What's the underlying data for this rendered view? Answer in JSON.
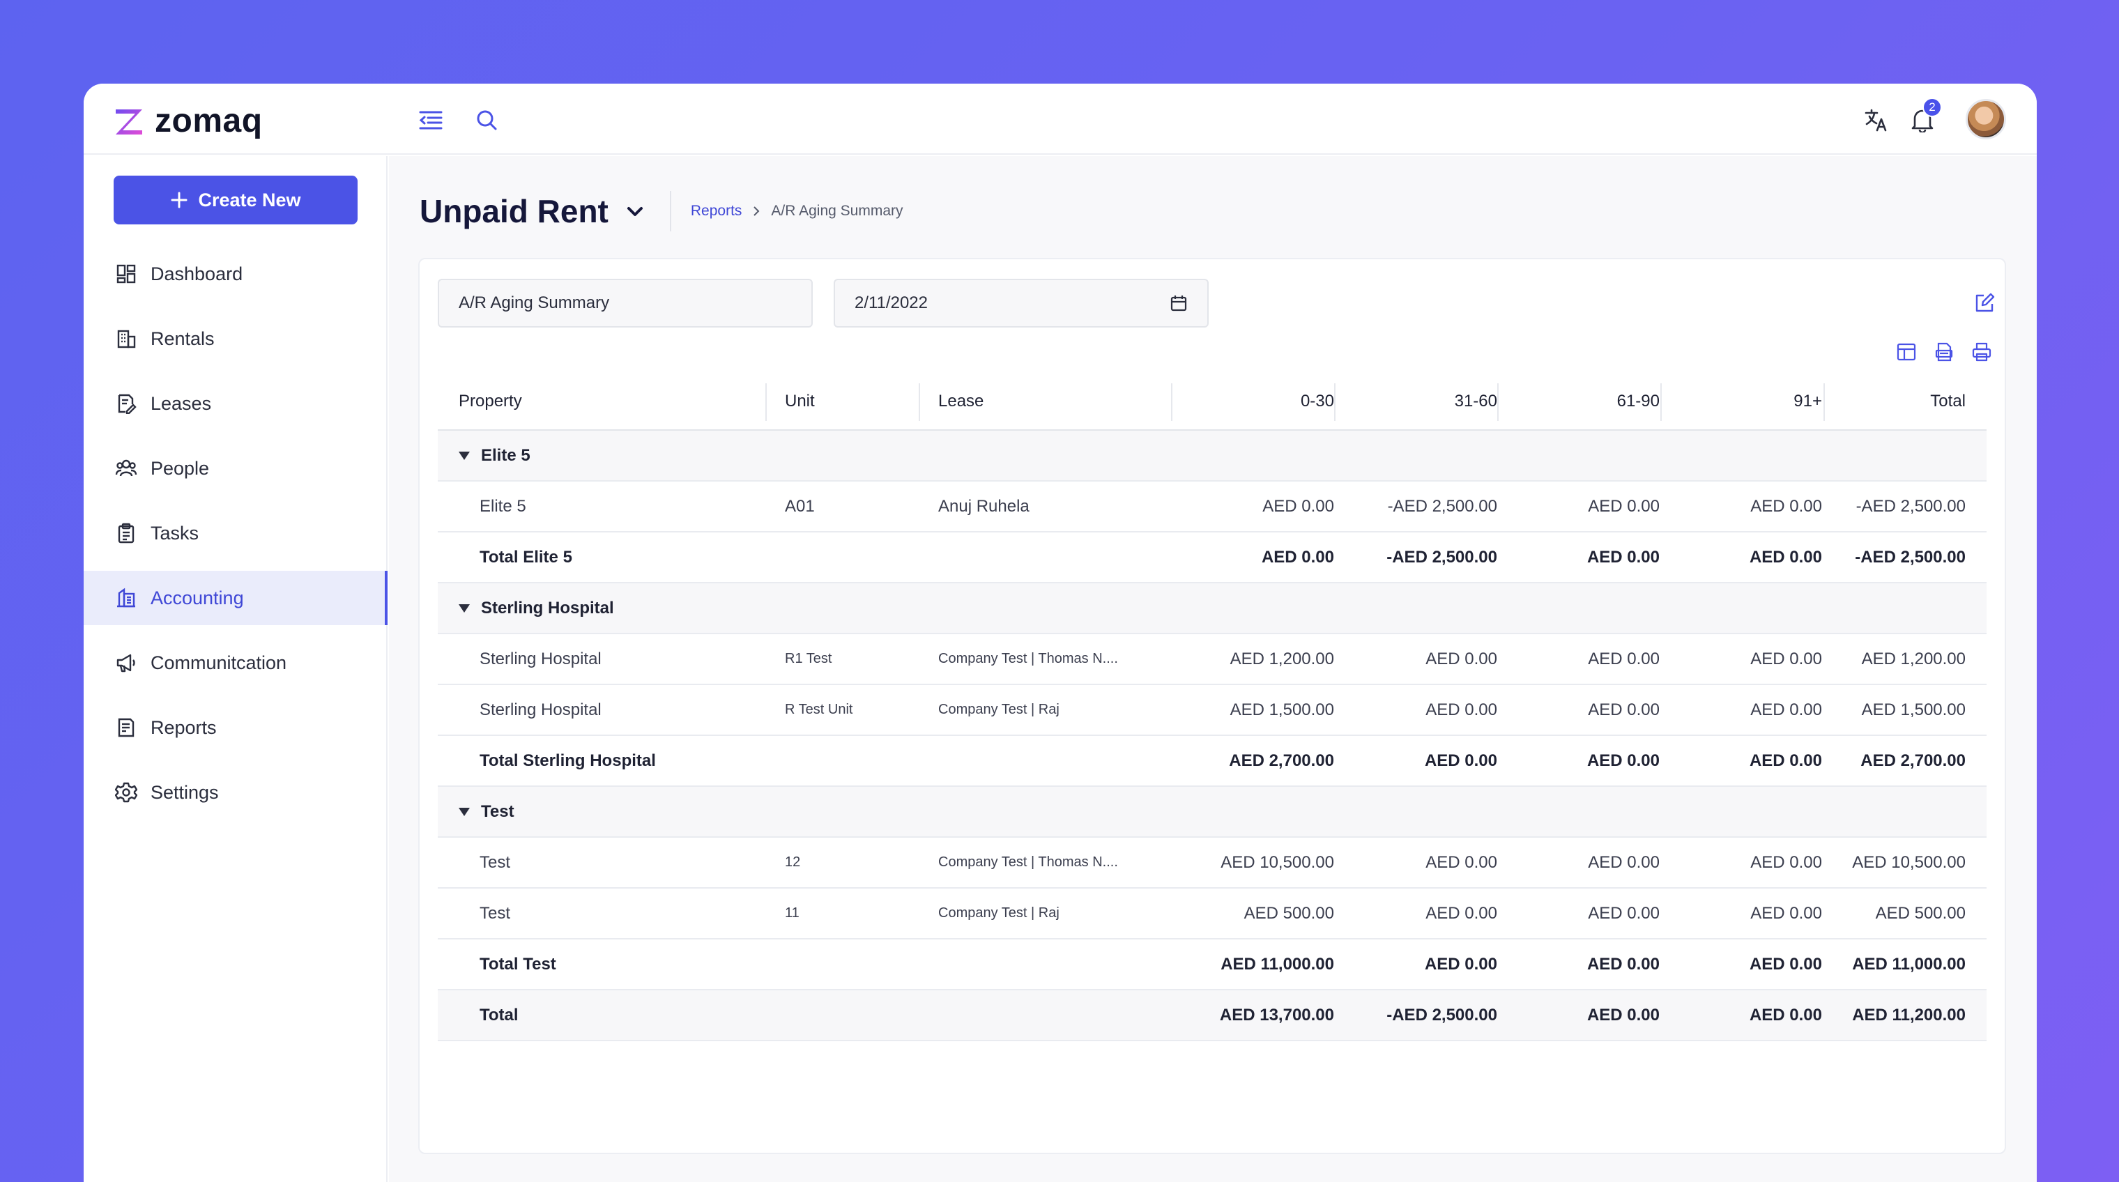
{
  "app": {
    "logo_text": "zomaq",
    "notifications_count": "2"
  },
  "topbar": {
    "icons": [
      "collapse-menu-icon",
      "search-icon",
      "translate-icon",
      "bell-icon"
    ]
  },
  "sidebar": {
    "create_label": "Create New",
    "items": [
      {
        "label": "Dashboard",
        "icon": "dashboard-icon"
      },
      {
        "label": "Rentals",
        "icon": "building-icon"
      },
      {
        "label": "Leases",
        "icon": "lease-icon"
      },
      {
        "label": "People",
        "icon": "people-icon"
      },
      {
        "label": "Tasks",
        "icon": "clipboard-icon"
      },
      {
        "label": "Accounting",
        "icon": "accounting-icon",
        "active": true
      },
      {
        "label": "Communitcation",
        "icon": "megaphone-icon"
      },
      {
        "label": "Reports",
        "icon": "report-icon"
      },
      {
        "label": "Settings",
        "icon": "gear-icon"
      }
    ]
  },
  "header": {
    "title": "Unpaid Rent",
    "breadcrumb": {
      "link": "Reports",
      "current": "A/R Aging Summary"
    }
  },
  "filters": {
    "report_value": "A/R Aging Summary",
    "date_value": "2/11/2022"
  },
  "table": {
    "columns": [
      "Property",
      "Unit",
      "Lease",
      "0-30",
      "31-60",
      "61-90",
      "91+",
      "Total"
    ],
    "groups": [
      {
        "name": "Elite 5",
        "rows": [
          {
            "property": "Elite 5",
            "unit": "A01",
            "lease": "Anuj Ruhela",
            "c030": "AED 0.00",
            "c3160": "-AED 2,500.00",
            "c6190": "AED 0.00",
            "c91": "AED 0.00",
            "total": "-AED 2,500.00"
          }
        ],
        "total": {
          "label": "Total Elite 5",
          "c030": "AED 0.00",
          "c3160": "-AED 2,500.00",
          "c6190": "AED 0.00",
          "c91": "AED 0.00",
          "total": "-AED 2,500.00"
        }
      },
      {
        "name": "Sterling Hospital",
        "rows": [
          {
            "property": "Sterling Hospital",
            "unit": "R1 Test",
            "lease": "Company Test | Thomas N....",
            "c030": "AED 1,200.00",
            "c3160": "AED 0.00",
            "c6190": "AED 0.00",
            "c91": "AED 0.00",
            "total": "AED 1,200.00"
          },
          {
            "property": "Sterling Hospital",
            "unit": "R Test Unit",
            "lease": "Company Test | Raj",
            "c030": "AED 1,500.00",
            "c3160": "AED 0.00",
            "c6190": "AED 0.00",
            "c91": "AED 0.00",
            "total": "AED 1,500.00"
          }
        ],
        "total": {
          "label": "Total Sterling Hospital",
          "c030": "AED 2,700.00",
          "c3160": "AED 0.00",
          "c6190": "AED 0.00",
          "c91": "AED 0.00",
          "total": "AED 2,700.00"
        }
      },
      {
        "name": "Test",
        "rows": [
          {
            "property": "Test",
            "unit": "12",
            "lease": "Company Test | Thomas N....",
            "c030": "AED 10,500.00",
            "c3160": "AED 0.00",
            "c6190": "AED 0.00",
            "c91": "AED 0.00",
            "total": "AED 10,500.00"
          },
          {
            "property": "Test",
            "unit": "11",
            "lease": "Company Test | Raj",
            "c030": "AED 500.00",
            "c3160": "AED 0.00",
            "c6190": "AED 0.00",
            "c91": "AED 0.00",
            "total": "AED 500.00"
          }
        ],
        "total": {
          "label": "Total Test",
          "c030": "AED 11,000.00",
          "c3160": "AED 0.00",
          "c6190": "AED 0.00",
          "c91": "AED 0.00",
          "total": "AED 11,000.00"
        }
      }
    ],
    "grand_total": {
      "label": "Total",
      "c030": "AED 13,700.00",
      "c3160": "-AED 2,500.00",
      "c6190": "AED 0.00",
      "c91": "AED 0.00",
      "total": "AED 11,200.00"
    }
  },
  "colors": {
    "accent": "#4b53e6",
    "background_start": "#5d63f0",
    "background_end": "#7d5ff3",
    "active_nav_bg": "#eaecfb"
  }
}
